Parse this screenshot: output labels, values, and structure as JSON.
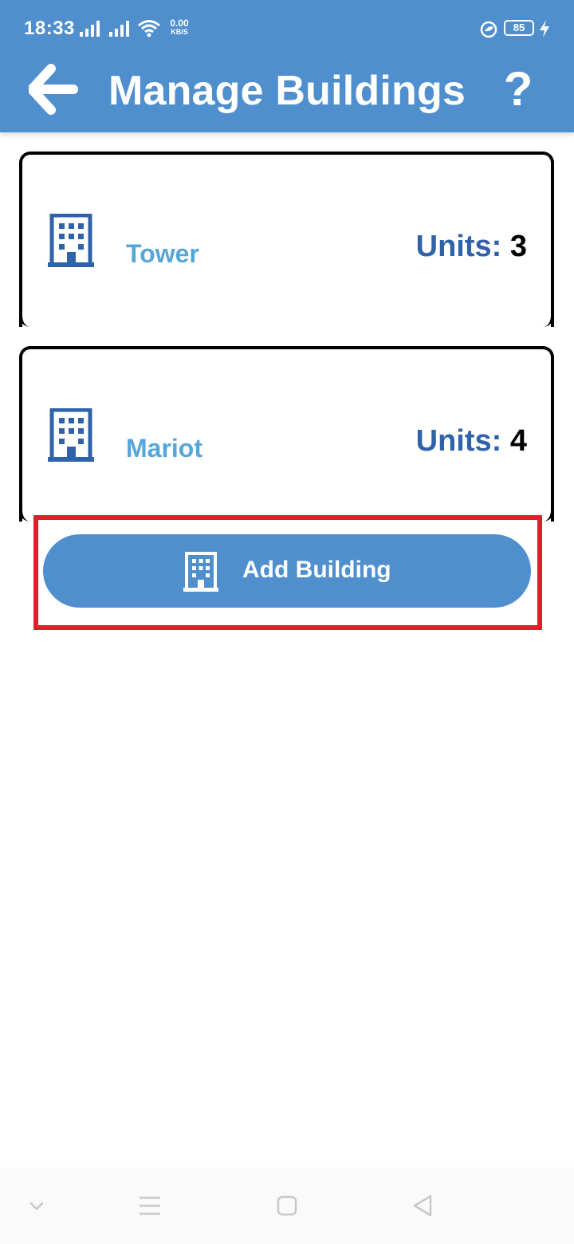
{
  "status_bar": {
    "time": "18:33",
    "net_speed_value": "0.00",
    "net_speed_unit": "KB/S",
    "battery_level": "85"
  },
  "app_bar": {
    "title": "Manage Buildings",
    "back_icon": "arrow-left-icon",
    "help_label": "?"
  },
  "buildings": [
    {
      "name": "Tower",
      "units_label": "Units:",
      "units": "3",
      "icon": "building-icon"
    },
    {
      "name": "Mariot",
      "units_label": "Units:",
      "units": "4",
      "icon": "building-icon"
    }
  ],
  "add_button": {
    "label": "Add Building",
    "icon": "building-icon"
  },
  "nav_bar": {
    "buttons": [
      "chevron-down-icon",
      "menu-icon",
      "home-square-icon",
      "back-triangle-icon"
    ]
  },
  "colors": {
    "primary": "#4f8fce",
    "building_name": "#55a6d9",
    "units_label": "#2f62a8",
    "highlight": "#e11d2a"
  }
}
